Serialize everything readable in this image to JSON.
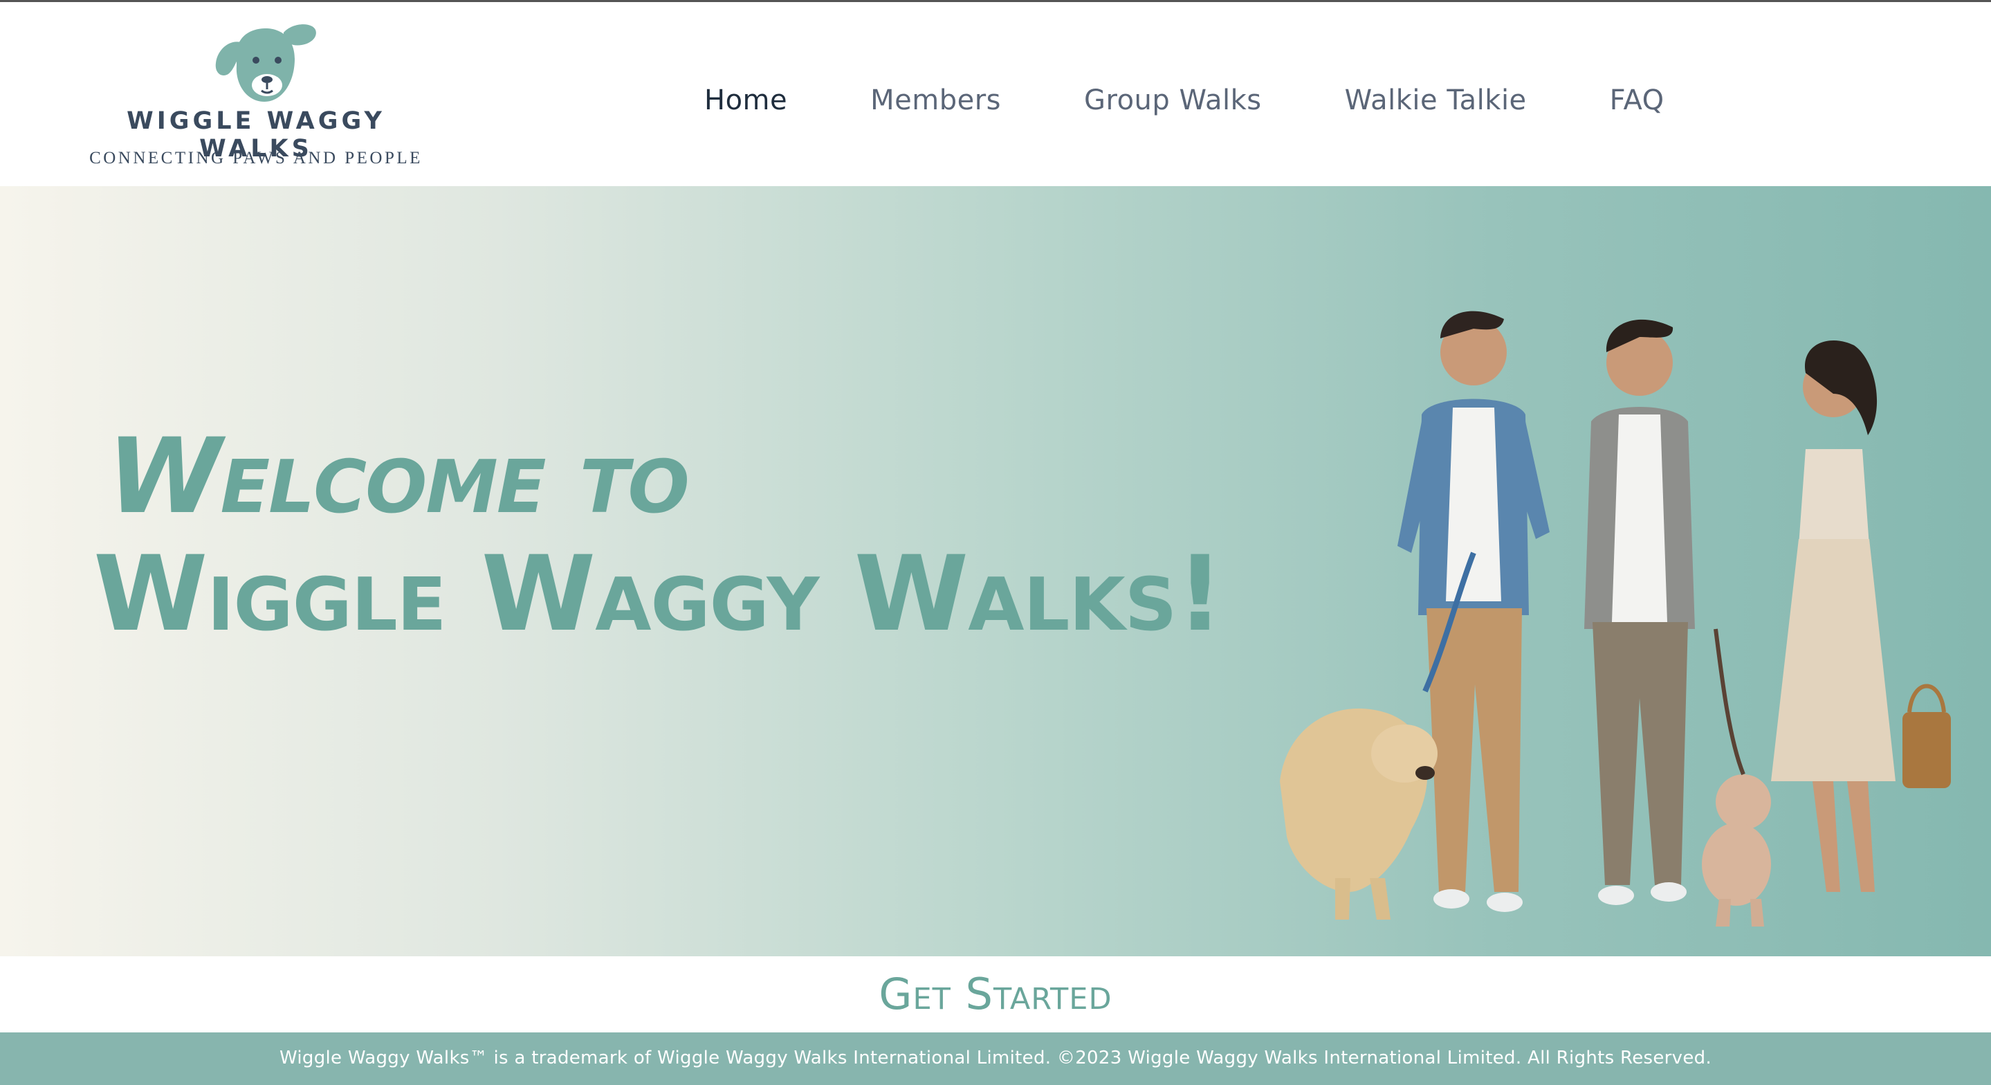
{
  "brand": {
    "name": "WIGGLE WAGGY WALKS",
    "tagline": "CONNECTING PAWS AND PEOPLE",
    "logo_icon": "dog-head-icon",
    "color_dark": "#3a4a5e",
    "color_accent": "#6aa69b"
  },
  "nav": {
    "items": [
      {
        "label": "Home",
        "active": true
      },
      {
        "label": "Members",
        "active": false
      },
      {
        "label": "Group Walks",
        "active": false
      },
      {
        "label": "Walkie Talkie",
        "active": false
      },
      {
        "label": "FAQ",
        "active": false
      }
    ]
  },
  "hero": {
    "line1": "Welcome to",
    "line2": "Wiggle Waggy Walks!",
    "gradient_start": "#f6f4ec",
    "gradient_end": "#85b8b0"
  },
  "cta": {
    "label": "Get Started"
  },
  "footer": {
    "text": "Wiggle Waggy Walks™ is a trademark of Wiggle Waggy Walks International Limited. ©2023 Wiggle Waggy Walks International Limited. All Rights Reserved.",
    "background": "#87b5ae"
  }
}
